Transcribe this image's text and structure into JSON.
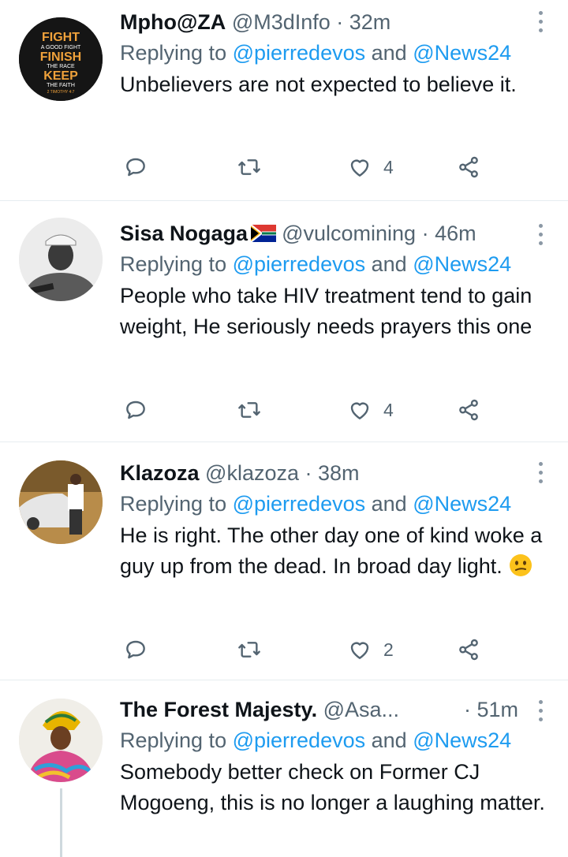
{
  "tweets": [
    {
      "name": "Mpho@ZA",
      "handle_time": "@M3dInfo · 32m",
      "reply_prefix": "Replying to",
      "mention1": "@pierredevos",
      "and": "and",
      "mention2": "@News24",
      "body": "Unbelievers are not expected to believe it.",
      "likes": "4",
      "avatar_text": {
        "l1": "FIGHT",
        "l2": "A GOOD FIGHT",
        "l3": "FINISH",
        "l4": "THE RACE",
        "l5": "KEEP",
        "l6": "THE FAITH",
        "l7": "2 TIMOTHY 4:7"
      }
    },
    {
      "name": "Sisa Nogaga",
      "handle_time": "@vulcomining · 46m",
      "reply_prefix": "Replying to",
      "mention1": "@pierredevos",
      "and": "and",
      "mention2": "@News24",
      "body": "People who take HIV treatment tend to gain weight, He seriously needs prayers this one",
      "likes": "4"
    },
    {
      "name": "Klazoza",
      "handle_time": "@klazoza · 38m",
      "reply_prefix": "Replying to",
      "mention1": "@pierredevos",
      "and": "and",
      "mention2": "@News24",
      "body": "He is right. The other day one of kind woke a guy up from the dead. In broad day light.",
      "likes": "2"
    },
    {
      "name": "The Forest Majesty.",
      "handle_time": "@Asa...",
      "time": "· 51m",
      "reply_prefix": "Replying to",
      "mention1": "@pierredevos",
      "and": "and",
      "mention2": "@News24",
      "body": "Somebody better check on Former CJ Mogoeng, this is no longer a laughing matter."
    }
  ],
  "icons": {
    "reply": "reply-icon",
    "retweet": "retweet-icon",
    "like": "heart-icon",
    "share": "share-icon",
    "more": "more-vertical-icon",
    "flag": "south-africa-flag-icon",
    "emoji": "confused-face-emoji"
  },
  "colors": {
    "mention": "#1d9bf0",
    "secondary_text": "#536471",
    "icon": "#536471",
    "divider": "#e6ecf0"
  }
}
